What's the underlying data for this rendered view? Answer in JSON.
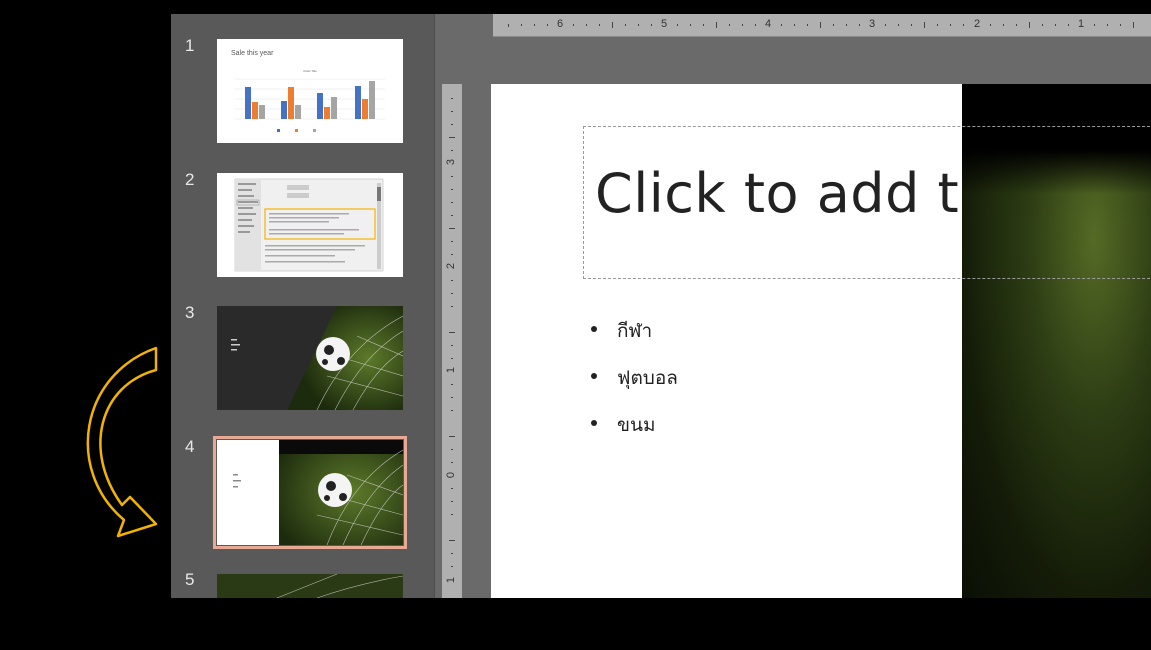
{
  "thumbnails": [
    {
      "number": "1",
      "title": "Sale this year",
      "chart_title": "Chart Title",
      "kind": "chart",
      "selected": false
    },
    {
      "number": "2",
      "kind": "options-dialog",
      "selected": false
    },
    {
      "number": "3",
      "kind": "photo-dark",
      "selected": false
    },
    {
      "number": "4",
      "kind": "photo-white-left",
      "selected": true
    },
    {
      "number": "5",
      "kind": "photo",
      "selected": false
    }
  ],
  "ruler_top_labels": [
    "6",
    "5",
    "4",
    "3",
    "2",
    "1"
  ],
  "ruler_left_labels": [
    "3",
    "2",
    "1",
    "0",
    "1"
  ],
  "slide": {
    "title_placeholder": "Click to add tit",
    "bullets": [
      "กีฬา",
      "ฟุตบอล",
      "ขนม"
    ]
  },
  "colors": {
    "selection_outline": "#e7a993",
    "arrow": "#f2b300",
    "chart_blue": "#4472c4",
    "chart_orange": "#ed7d31",
    "chart_gray": "#a5a5a5"
  },
  "annotation": {
    "icon": "curved-arrow-icon"
  }
}
